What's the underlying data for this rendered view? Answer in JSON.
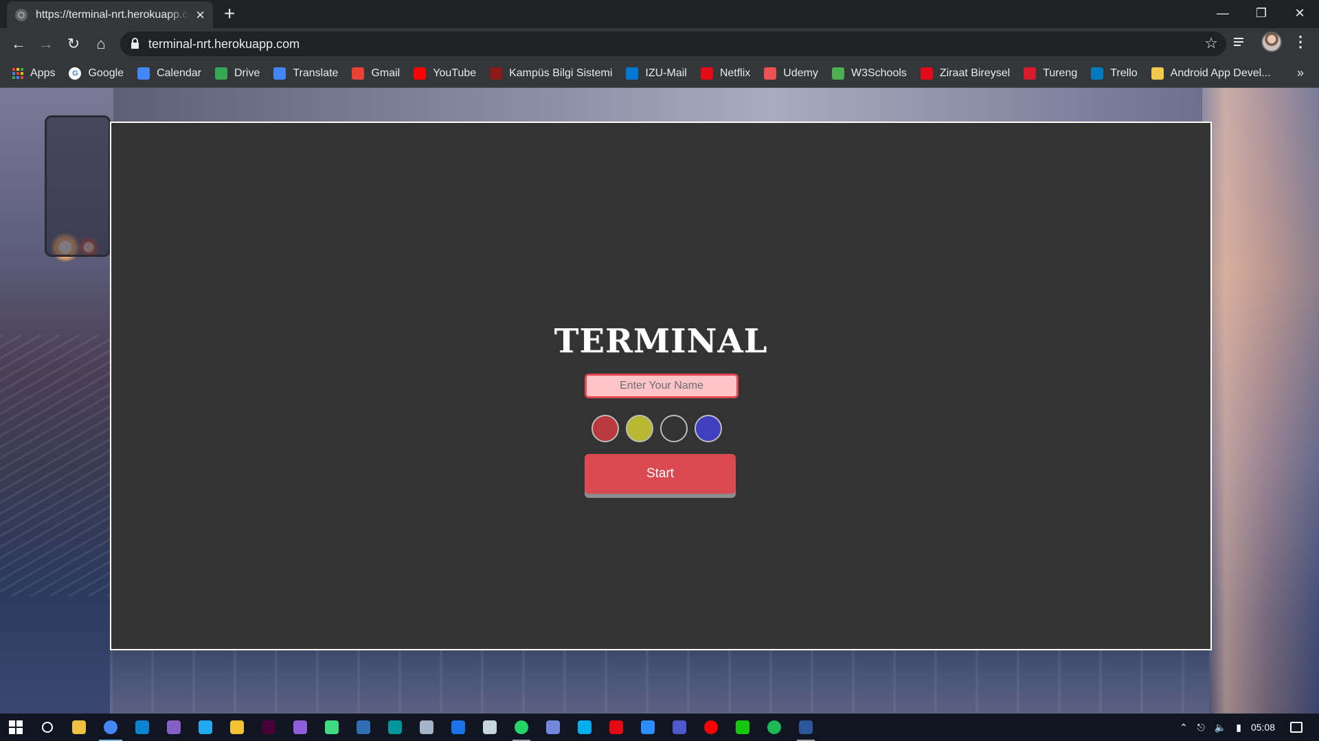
{
  "browser": {
    "tab_title": "https://terminal-nrt.herokuapp.com",
    "url": "terminal-nrt.herokuapp.com",
    "new_tab": "+",
    "close_tab": "×"
  },
  "bookmarks": [
    {
      "label": "Apps",
      "icon": "apps-grid-icon",
      "color": "#ea4335"
    },
    {
      "label": "Google",
      "icon": "google-icon",
      "color": "#4285f4"
    },
    {
      "label": "Calendar",
      "icon": "calendar-icon",
      "color": "#4285f4"
    },
    {
      "label": "Drive",
      "icon": "drive-icon",
      "color": "#34a853"
    },
    {
      "label": "Translate",
      "icon": "translate-icon",
      "color": "#4285f4"
    },
    {
      "label": "Gmail",
      "icon": "gmail-icon",
      "color": "#ea4335"
    },
    {
      "label": "YouTube",
      "icon": "youtube-icon",
      "color": "#ff0000"
    },
    {
      "label": "Kampüs Bilgi Sistemi",
      "icon": "campus-icon",
      "color": "#8b1a1a"
    },
    {
      "label": "IZU-Mail",
      "icon": "outlook-icon",
      "color": "#0078d4"
    },
    {
      "label": "Netflix",
      "icon": "netflix-icon",
      "color": "#e50914"
    },
    {
      "label": "Udemy",
      "icon": "udemy-icon",
      "color": "#ec5252"
    },
    {
      "label": "W3Schools",
      "icon": "w3schools-icon",
      "color": "#4caf50"
    },
    {
      "label": "Ziraat Bireysel",
      "icon": "ziraat-icon",
      "color": "#e30a17"
    },
    {
      "label": "Tureng",
      "icon": "tureng-icon",
      "color": "#d81b2c"
    },
    {
      "label": "Trello",
      "icon": "trello-icon",
      "color": "#0079bf"
    },
    {
      "label": "Android App Devel...",
      "icon": "folder-icon",
      "color": "#f2c94c"
    }
  ],
  "page": {
    "title": "TERMINAL",
    "name_placeholder": "Enter Your Name",
    "name_value": "",
    "start_label": "Start",
    "colors": [
      {
        "name": "red",
        "value": "#b9393e"
      },
      {
        "name": "yellow",
        "value": "#b8b833"
      },
      {
        "name": "black",
        "value": "#333333"
      },
      {
        "name": "blue",
        "value": "#3f3fbf"
      }
    ]
  },
  "taskbar": {
    "apps": [
      {
        "name": "search",
        "color": "#ffffff"
      },
      {
        "name": "file-explorer",
        "color": "#f0c040"
      },
      {
        "name": "chrome",
        "color": "#4285f4",
        "active": true
      },
      {
        "name": "edge",
        "color": "#0a84d0"
      },
      {
        "name": "visual-studio",
        "color": "#865fc5"
      },
      {
        "name": "vscode",
        "color": "#23a9f2"
      },
      {
        "name": "git",
        "color": "#f1c232"
      },
      {
        "name": "adobe-xd",
        "color": "#470137"
      },
      {
        "name": "podcast",
        "color": "#8e5fd9"
      },
      {
        "name": "android-studio",
        "color": "#3ddc84"
      },
      {
        "name": "database",
        "color": "#2f6db5"
      },
      {
        "name": "arduino",
        "color": "#00979c"
      },
      {
        "name": "eye",
        "color": "#a3b4c8"
      },
      {
        "name": "shield",
        "color": "#1a73e8"
      },
      {
        "name": "steam",
        "color": "#c7d5e0"
      },
      {
        "name": "whatsapp",
        "color": "#25d366",
        "running": true
      },
      {
        "name": "discord",
        "color": "#7289da"
      },
      {
        "name": "skype",
        "color": "#00aff0"
      },
      {
        "name": "netflix",
        "color": "#e50914"
      },
      {
        "name": "zoom",
        "color": "#2d8cff"
      },
      {
        "name": "teams",
        "color": "#5059c9"
      },
      {
        "name": "youtube-music",
        "color": "#ff0000"
      },
      {
        "name": "terminal",
        "color": "#16c60c"
      },
      {
        "name": "spotify",
        "color": "#1db954"
      },
      {
        "name": "word",
        "color": "#2b579a",
        "running": true
      }
    ],
    "clock": "05:08"
  }
}
